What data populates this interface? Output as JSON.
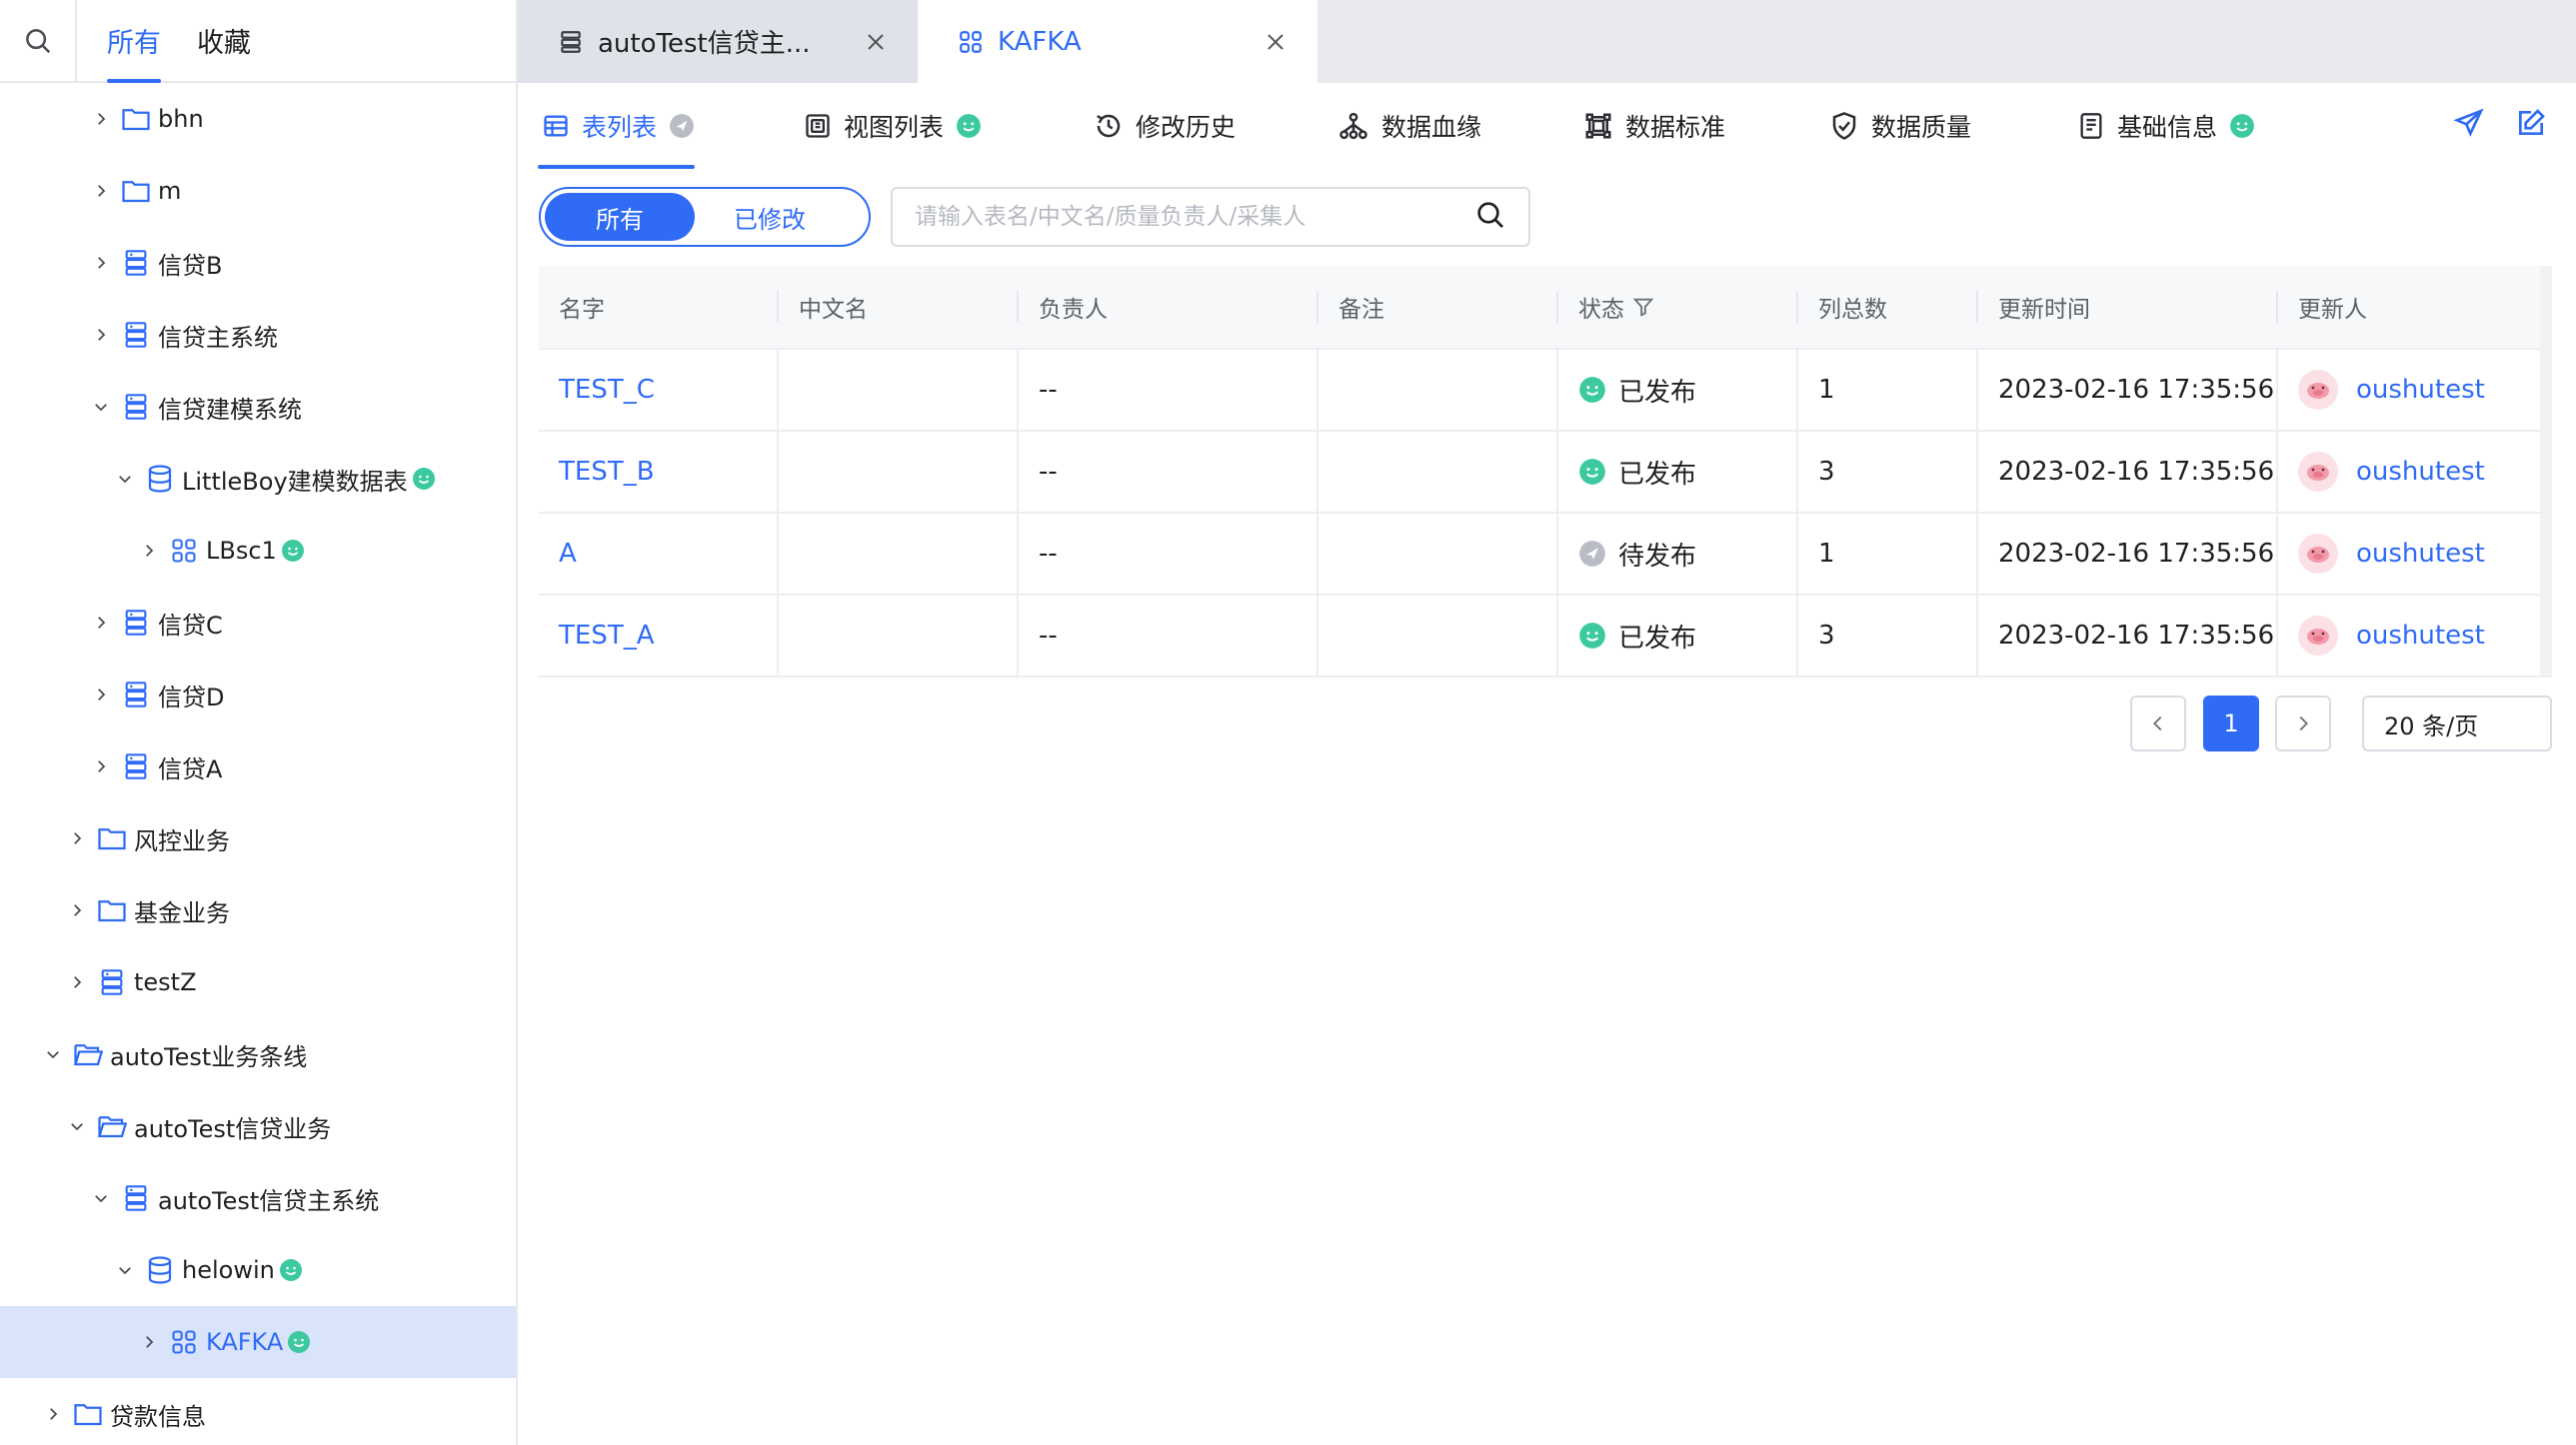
{
  "sidebar": {
    "tabs": [
      {
        "label": "所有",
        "active": true
      },
      {
        "label": "收藏",
        "active": false
      }
    ],
    "tree": [
      {
        "label": "bhn",
        "icon": "folder-icon",
        "expanded": false
      },
      {
        "label": "m",
        "icon": "folder-icon",
        "expanded": false
      },
      {
        "label": "信贷B",
        "icon": "system-icon",
        "expanded": false
      },
      {
        "label": "信贷主系统",
        "icon": "system-icon",
        "expanded": false
      },
      {
        "label": "信贷建模系统",
        "icon": "system-icon",
        "expanded": true
      },
      {
        "label": "LittleBoy建模数据表",
        "icon": "database-icon",
        "expanded": true,
        "status": "published"
      },
      {
        "label": "LBsc1",
        "icon": "schema-icon",
        "expanded": false,
        "status": "published"
      },
      {
        "label": "信贷C",
        "icon": "system-icon",
        "expanded": false
      },
      {
        "label": "信贷D",
        "icon": "system-icon",
        "expanded": false
      },
      {
        "label": "信贷A",
        "icon": "system-icon",
        "expanded": false
      },
      {
        "label": "风控业务",
        "icon": "folder-icon",
        "expanded": false
      },
      {
        "label": "基金业务",
        "icon": "folder-icon",
        "expanded": false
      },
      {
        "label": "testZ",
        "icon": "system-icon",
        "expanded": false
      },
      {
        "label": "autoTest业务条线",
        "icon": "folder-open-icon",
        "expanded": true
      },
      {
        "label": "autoTest信贷业务",
        "icon": "folder-open-icon",
        "expanded": true
      },
      {
        "label": "autoTest信贷主系统",
        "icon": "system-icon",
        "expanded": true
      },
      {
        "label": "helowin",
        "icon": "database-icon",
        "expanded": true,
        "status": "published"
      },
      {
        "label": "KAFKA",
        "icon": "schema-icon",
        "expanded": false,
        "status": "published",
        "selected": true
      },
      {
        "label": "贷款信息",
        "icon": "folder-icon",
        "expanded": false
      }
    ]
  },
  "tabs": [
    {
      "label": "autoTest信贷主...",
      "icon": "system-icon",
      "active": false
    },
    {
      "label": "KAFKA",
      "icon": "schema-icon",
      "active": true
    }
  ],
  "subnav": [
    {
      "label": "表列表",
      "icon": "table-icon",
      "active": true,
      "badge": "pending"
    },
    {
      "label": "视图列表",
      "icon": "view-icon",
      "active": false,
      "badge": "published"
    },
    {
      "label": "修改历史",
      "icon": "history-icon",
      "active": false
    },
    {
      "label": "数据血缘",
      "icon": "lineage-icon",
      "active": false
    },
    {
      "label": "数据标准",
      "icon": "standard-icon",
      "active": false
    },
    {
      "label": "数据质量",
      "icon": "shield-icon",
      "active": false
    },
    {
      "label": "基础信息",
      "icon": "document-icon",
      "active": false,
      "badge": "published"
    }
  ],
  "filter": {
    "options": [
      "所有",
      "已修改"
    ],
    "selected": "所有",
    "search_placeholder": "请输入表名/中文名/质量负责人/采集人",
    "search_value": ""
  },
  "table": {
    "columns": [
      "名字",
      "中文名",
      "负责人",
      "备注",
      "状态",
      "列总数",
      "更新时间",
      "更新人"
    ],
    "rows": [
      {
        "name": "TEST_C",
        "cn_name": "",
        "owner": "--",
        "remark": "",
        "status": "已发布",
        "status_type": "published",
        "col_count": "1",
        "updated": "2023-02-16 17:35:56",
        "updater": "oushutest"
      },
      {
        "name": "TEST_B",
        "cn_name": "",
        "owner": "--",
        "remark": "",
        "status": "已发布",
        "status_type": "published",
        "col_count": "3",
        "updated": "2023-02-16 17:35:56",
        "updater": "oushutest"
      },
      {
        "name": "A",
        "cn_name": "",
        "owner": "--",
        "remark": "",
        "status": "待发布",
        "status_type": "pending",
        "col_count": "1",
        "updated": "2023-02-16 17:35:56",
        "updater": "oushutest"
      },
      {
        "name": "TEST_A",
        "cn_name": "",
        "owner": "--",
        "remark": "",
        "status": "已发布",
        "status_type": "published",
        "col_count": "3",
        "updated": "2023-02-16 17:35:56",
        "updater": "oushutest"
      }
    ]
  },
  "pagination": {
    "current": "1",
    "page_size": "20 条/页"
  },
  "colors": {
    "accent": "#2f6bf5",
    "published": "#3cc9a0",
    "pending": "#b9bcc4",
    "selected_bg": "#d9e3fa"
  }
}
